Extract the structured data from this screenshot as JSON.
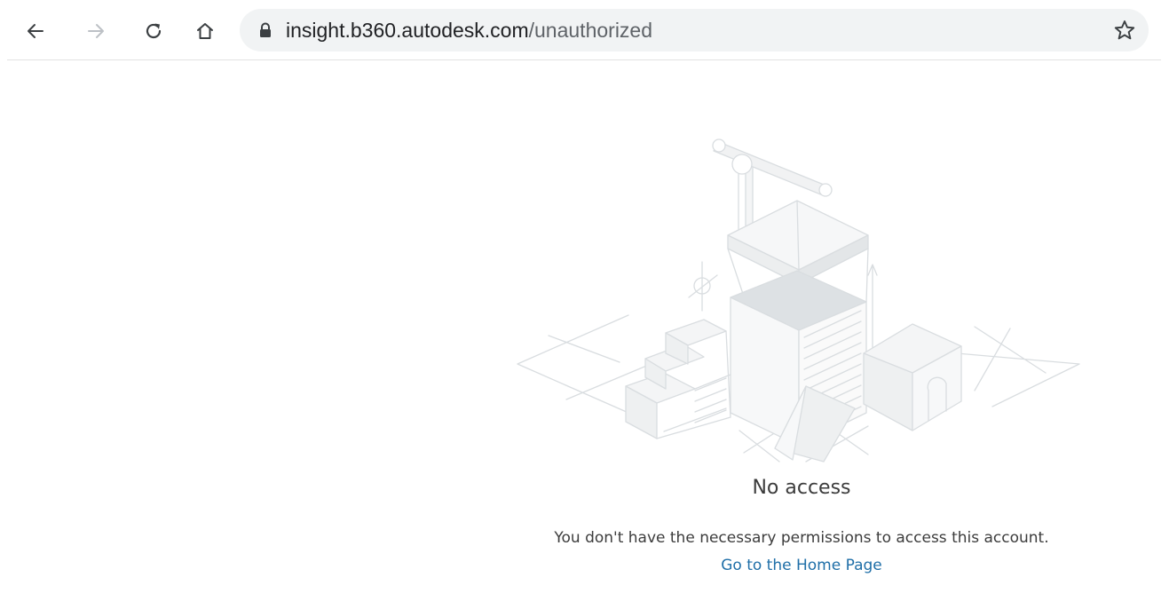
{
  "browser": {
    "url_host": "insight.b360.autodesk.com",
    "url_path": "/unauthorized",
    "icons": {
      "back": "back-arrow-icon",
      "forward": "forward-arrow-icon",
      "reload": "reload-icon",
      "home": "home-icon",
      "secure": "lock-icon",
      "bookmark": "star-icon"
    }
  },
  "page": {
    "illustration": "no-access-illustration",
    "title": "No access",
    "message": "You don't have the necessary permissions to access this account.",
    "home_link": "Go to the Home Page",
    "colors": {
      "text": "#3c3c3c",
      "link": "#1f6fa8",
      "omnibox_bg": "#f1f3f4"
    }
  }
}
